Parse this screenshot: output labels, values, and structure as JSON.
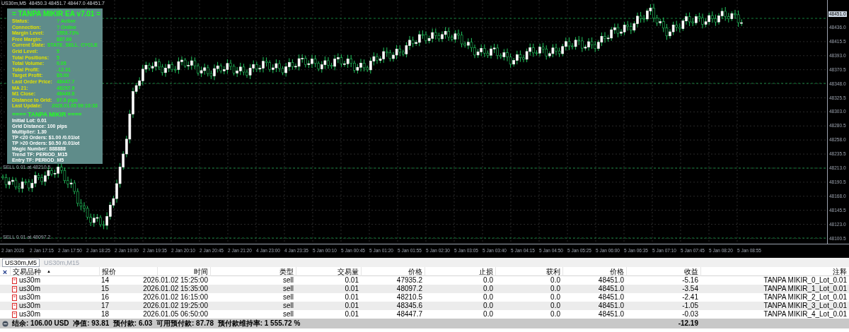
{
  "chart": {
    "header": "US30m,M5  48450.3 48451.7 48447.0 48451.7",
    "current_price": "48451.0",
    "price_ticks": [
      "48436.0",
      "48415.5",
      "48393.0",
      "48370.5",
      "48348.0",
      "48325.5",
      "48303.0",
      "48280.5",
      "48258.0",
      "48235.5",
      "48213.0",
      "48190.5",
      "48168.0",
      "48145.5",
      "48123.0",
      "48100.5"
    ],
    "time_ticks": [
      "2 Jan 2026",
      "2 Jan 17:15",
      "2 Jan 17:50",
      "2 Jan 18:25",
      "2 Jan 19:00",
      "2 Jan 19:35",
      "2 Jan 20:10",
      "2 Jan 20:45",
      "2 Jan 21:20",
      "4 Jan 23:00",
      "4 Jan 23:35",
      "5 Jan 00:10",
      "5 Jan 00:45",
      "5 Jan 01:20",
      "5 Jan 01:55",
      "5 Jan 02:30",
      "5 Jan 03:05",
      "5 Jan 03:40",
      "5 Jan 04:15",
      "5 Jan 04:50",
      "5 Jan 05:25",
      "5 Jan 06:00",
      "5 Jan 06:35",
      "5 Jan 07:10",
      "5 Jan 07:45",
      "5 Jan 08:20",
      "5 Jan 08:55"
    ],
    "order_lines": [
      {
        "label": "SELL 0.01 at 48210.5"
      },
      {
        "label": "SELL 0.01 at 48097.2"
      }
    ]
  },
  "panel": {
    "title": "= TANPA MIKIR EA v7.01 =",
    "rows": [
      {
        "label": "Status:",
        "value": "? Active"
      },
      {
        "label": "Connection:",
        "value": "? Online"
      },
      {
        "label": "Margin Level:",
        "value": "1553.73%"
      },
      {
        "label": "Free Margin:",
        "value": "$87.66"
      },
      {
        "label": "Current State:",
        "value": "STATE_SELL_CYCLE"
      },
      {
        "label": "Grid Level:",
        "value": "5"
      },
      {
        "label": "Total Positions:",
        "value": "5"
      },
      {
        "label": "Total Volume:",
        "value": "0.05"
      },
      {
        "label": "Total Profit:",
        "value": "-12.31"
      },
      {
        "label": "Target Profit:",
        "value": "$5.00"
      },
      {
        "label": "Last Order Price:",
        "value": "48447.7"
      },
      {
        "label": "MA 21:",
        "value": "48297.9"
      },
      {
        "label": "M1 Close:",
        "value": "48449.8"
      },
      {
        "label": "Distance to Grid:",
        "value": "97.8 pips"
      },
      {
        "label": "Last Update:",
        "value": "2026.01.05 09:10:33"
      }
    ],
    "section_title": "==== TANPA MIKIR ====",
    "settings": [
      "Initial Lot: 0.01",
      "Grid Distance: 100 pips",
      "Multiplier: 1.30",
      "TP <20 Orders: $1.00 /0.01lot",
      "TP >20 Orders: $0.50 /0.01lot",
      "Magic Number: 888888",
      "Trend TF: PERIOD_M15",
      "Entry TF: PERIOD_M5"
    ]
  },
  "chart_tabs": [
    {
      "label": "US30m,M5",
      "selected": true
    },
    {
      "label": "US30m,M15",
      "selected": false
    }
  ],
  "table": {
    "close": "×",
    "sort_mark": "▲",
    "columns": [
      "交易品种",
      "报价",
      "时间",
      "类型",
      "交易量",
      "价格",
      "止损",
      "获利",
      "价格",
      "收益",
      "注释"
    ],
    "rows": [
      [
        "us30m",
        "14",
        "2026.01.02 15:25:00",
        "sell",
        "0.01",
        "47935.2",
        "0.0",
        "0.0",
        "48451.0",
        "-5.16",
        "TANPA MIKIR_0_Lot_0.01"
      ],
      [
        "us30m",
        "15",
        "2026.01.02 15:35:00",
        "sell",
        "0.01",
        "48097.2",
        "0.0",
        "0.0",
        "48451.0",
        "-3.54",
        "TANPA MIKIR_1_Lot_0.01"
      ],
      [
        "us30m",
        "16",
        "2026.01.02 16:15:00",
        "sell",
        "0.01",
        "48210.5",
        "0.0",
        "0.0",
        "48451.0",
        "-2.41",
        "TANPA MIKIR_2_Lot_0.01"
      ],
      [
        "us30m",
        "17",
        "2026.01.02 19:25:00",
        "sell",
        "0.01",
        "48345.6",
        "0.0",
        "0.0",
        "48451.0",
        "-1.05",
        "TANPA MIKIR_3_Lot_0.01"
      ],
      [
        "us30m",
        "18",
        "2026.01.05 06:50:00",
        "sell",
        "0.01",
        "48447.7",
        "0.0",
        "0.0",
        "48451.0",
        "-0.03",
        "TANPA MIKIR_4_Lot_0.01"
      ]
    ],
    "summary": "结余: 106.00 USD  净值: 93.81  预付款: 6.03  可用预付款: 87.78  预付款维持率: 1 555.72 %",
    "total": "-12.19"
  }
}
